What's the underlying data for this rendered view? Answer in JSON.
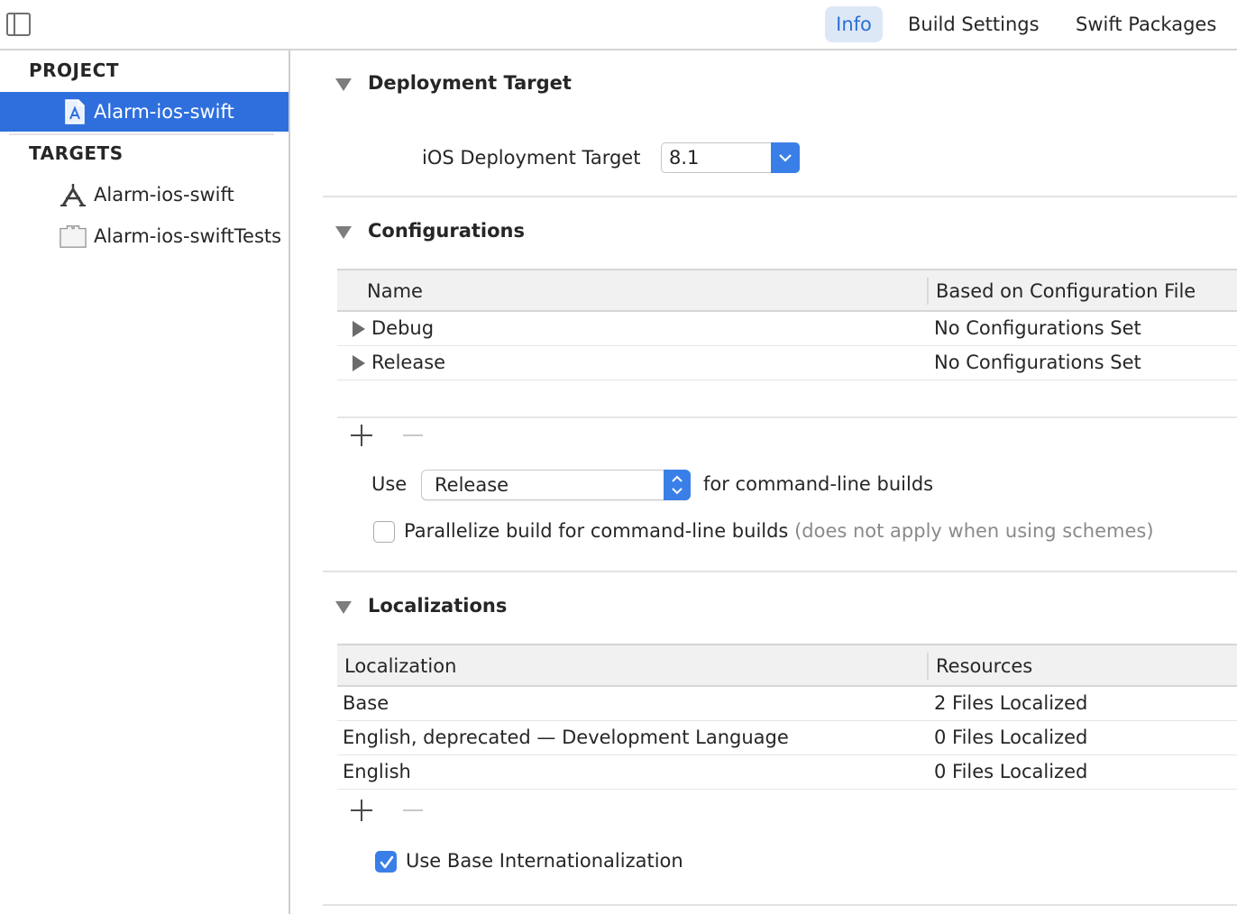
{
  "toolbar": {
    "tabs": [
      {
        "label": "Info",
        "active": true
      },
      {
        "label": "Build Settings",
        "active": false
      },
      {
        "label": "Swift Packages",
        "active": false
      }
    ],
    "sidebar_toggle_icon": "sidebar-toggle-icon"
  },
  "sidebar": {
    "project_header": "PROJECT",
    "project_item": {
      "label": "Alarm-ios-swift",
      "icon": "project-file-icon",
      "selected": true
    },
    "targets_header": "TARGETS",
    "targets": [
      {
        "label": "Alarm-ios-swift",
        "icon": "app-target-icon"
      },
      {
        "label": "Alarm-ios-swiftTests",
        "icon": "test-bundle-icon"
      }
    ]
  },
  "deployment": {
    "title": "Deployment Target",
    "field_label": "iOS Deployment Target",
    "field_value": "8.1"
  },
  "configurations": {
    "title": "Configurations",
    "columns": [
      "Name",
      "Based on Configuration File"
    ],
    "rows": [
      {
        "name": "Debug",
        "file": "No Configurations Set"
      },
      {
        "name": "Release",
        "file": "No Configurations Set"
      }
    ],
    "use_label": "Use",
    "use_value": "Release",
    "use_suffix": "for command-line builds",
    "parallelize_label": "Parallelize build for command-line builds",
    "parallelize_note": "(does not apply when using schemes)",
    "parallelize_checked": false
  },
  "localizations": {
    "title": "Localizations",
    "columns": [
      "Localization",
      "Resources"
    ],
    "rows": [
      {
        "name": "Base",
        "resources": "2 Files Localized"
      },
      {
        "name": "English, deprecated — Development Language",
        "resources": "0 Files Localized"
      },
      {
        "name": "English",
        "resources": "0 Files Localized"
      }
    ],
    "base_intl_label": "Use Base Internationalization",
    "base_intl_checked": true
  },
  "colors": {
    "accent": "#3a7fe8",
    "selection": "#2f6fdd"
  }
}
